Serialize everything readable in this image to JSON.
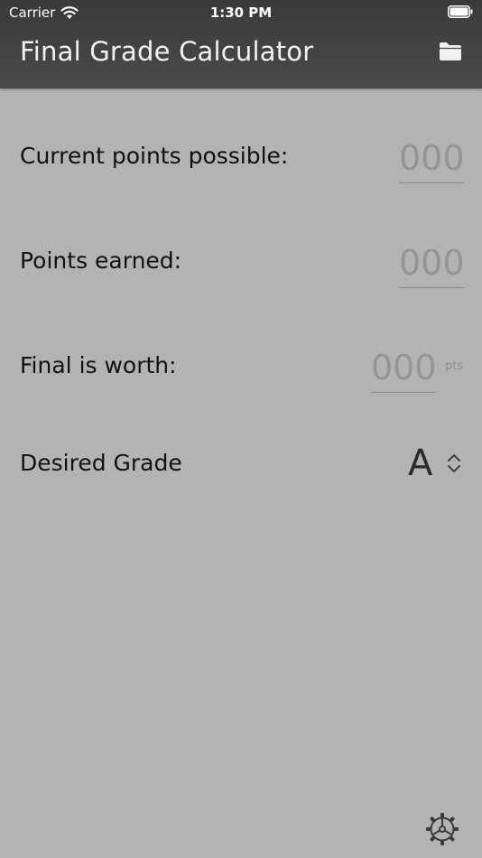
{
  "status_bar": {
    "carrier": "Carrier",
    "time": "1:30 PM"
  },
  "header": {
    "title": "Final Grade Calculator",
    "folder_icon": "folder-icon"
  },
  "fields": {
    "current_points_possible": {
      "label": "Current points possible:",
      "placeholder": "000"
    },
    "points_earned": {
      "label": "Points earned:",
      "placeholder": "000"
    },
    "final_worth": {
      "label": "Final is worth:",
      "placeholder": "000",
      "suffix": "pts"
    },
    "desired_grade": {
      "label": "Desired Grade",
      "value": "A"
    }
  },
  "footer": {
    "settings_icon": "gear-icon"
  },
  "colors": {
    "background": "#b3b3b3",
    "header": "#404040",
    "placeholder": "#959595"
  }
}
